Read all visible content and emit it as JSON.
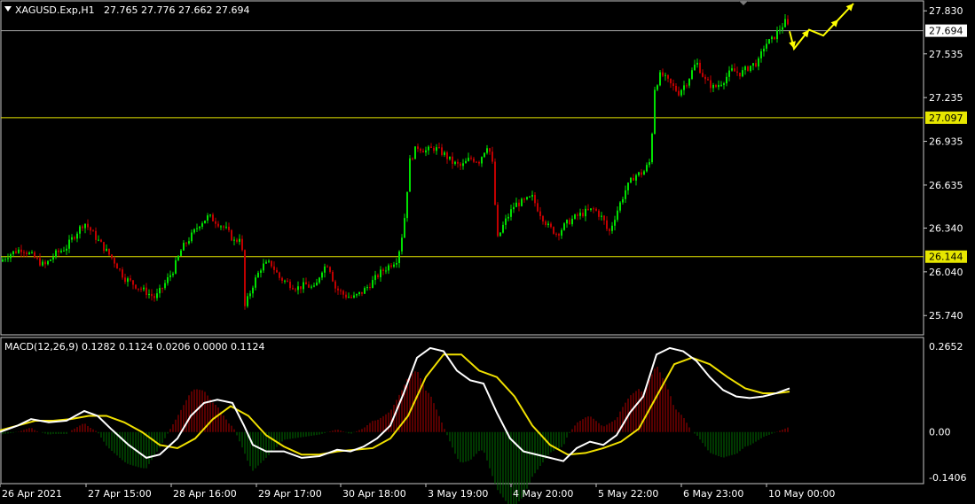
{
  "header": {
    "symbol": "XAGUSD.Exp,H1",
    "ohlc": "27.765 27.776 27.662 27.694"
  },
  "macd_header": "MACD(12,26,9) 0.1282 0.1124 0.0206 0.0000 0.1124",
  "colors": {
    "background": "#000000",
    "bull": "#00e000",
    "bear": "#c00000",
    "hline": "#e6e600",
    "bidline": "#a0a0a0",
    "macd_line": "#ffffff",
    "signal_line": "#f0e000",
    "hist_pos": "#b00000",
    "hist_neg": "#007000",
    "arrows": "#ffff00"
  },
  "chart_data": [
    {
      "type": "candlestick",
      "symbol": "XAGUSD.Exp",
      "timeframe": "H1",
      "price_ticks": [
        "27.830",
        "27.535",
        "27.235",
        "26.935",
        "26.635",
        "26.340",
        "26.040",
        "25.740"
      ],
      "ylim": [
        25.62,
        27.88
      ],
      "current_price": "27.694",
      "levels": [
        "27.097",
        "26.144"
      ],
      "x_ticks": [
        "26 Apr 2021",
        "27 Apr 15:00",
        "28 Apr 16:00",
        "29 Apr 17:00",
        "30 Apr 18:00",
        "3 May 19:00",
        "4 May 20:00",
        "5 May 22:00",
        "6 May 23:00",
        "10 May 00:00"
      ],
      "close_path": [
        [
          0,
          26.11
        ],
        [
          10,
          26.16
        ],
        [
          25,
          26.2
        ],
        [
          38,
          26.14
        ],
        [
          50,
          26.08
        ],
        [
          62,
          26.16
        ],
        [
          75,
          26.21
        ],
        [
          85,
          26.3
        ],
        [
          95,
          26.38
        ],
        [
          105,
          26.3
        ],
        [
          115,
          26.22
        ],
        [
          128,
          26.12
        ],
        [
          140,
          26.0
        ],
        [
          152,
          25.95
        ],
        [
          165,
          25.9
        ],
        [
          175,
          25.86
        ],
        [
          185,
          25.95
        ],
        [
          195,
          26.05
        ],
        [
          205,
          26.2
        ],
        [
          215,
          26.28
        ],
        [
          225,
          26.37
        ],
        [
          235,
          26.42
        ],
        [
          245,
          26.38
        ],
        [
          255,
          26.33
        ],
        [
          265,
          26.24
        ],
        [
          272,
          26.3
        ],
        [
          276,
          25.8
        ],
        [
          285,
          25.95
        ],
        [
          295,
          26.08
        ],
        [
          305,
          26.1
        ],
        [
          315,
          26.0
        ],
        [
          325,
          25.96
        ],
        [
          335,
          25.93
        ],
        [
          345,
          25.95
        ],
        [
          355,
          25.92
        ],
        [
          362,
          26.05
        ],
        [
          370,
          26.1
        ],
        [
          378,
          25.93
        ],
        [
          388,
          25.88
        ],
        [
          398,
          25.86
        ],
        [
          408,
          25.9
        ],
        [
          418,
          25.96
        ],
        [
          428,
          26.03
        ],
        [
          438,
          26.08
        ],
        [
          448,
          26.13
        ],
        [
          455,
          26.35
        ],
        [
          462,
          26.8
        ],
        [
          470,
          26.9
        ],
        [
          480,
          26.87
        ],
        [
          490,
          26.89
        ],
        [
          500,
          26.85
        ],
        [
          510,
          26.79
        ],
        [
          520,
          26.76
        ],
        [
          530,
          26.82
        ],
        [
          540,
          26.8
        ],
        [
          550,
          26.92
        ],
        [
          556,
          26.75
        ],
        [
          560,
          26.25
        ],
        [
          568,
          26.37
        ],
        [
          580,
          26.5
        ],
        [
          590,
          26.52
        ],
        [
          600,
          26.55
        ],
        [
          608,
          26.45
        ],
        [
          618,
          26.35
        ],
        [
          628,
          26.3
        ],
        [
          640,
          26.38
        ],
        [
          650,
          26.42
        ],
        [
          660,
          26.45
        ],
        [
          670,
          26.47
        ],
        [
          680,
          26.4
        ],
        [
          686,
          26.3
        ],
        [
          695,
          26.45
        ],
        [
          705,
          26.6
        ],
        [
          715,
          26.7
        ],
        [
          725,
          26.72
        ],
        [
          733,
          26.8
        ],
        [
          738,
          27.3
        ],
        [
          745,
          27.4
        ],
        [
          755,
          27.33
        ],
        [
          765,
          27.27
        ],
        [
          775,
          27.35
        ],
        [
          785,
          27.48
        ],
        [
          795,
          27.35
        ],
        [
          805,
          27.3
        ],
        [
          815,
          27.35
        ],
        [
          825,
          27.42
        ],
        [
          835,
          27.4
        ],
        [
          845,
          27.45
        ],
        [
          855,
          27.48
        ],
        [
          862,
          27.6
        ],
        [
          870,
          27.63
        ],
        [
          878,
          27.7
        ],
        [
          886,
          27.76
        ],
        [
          890,
          27.69
        ]
      ],
      "forecast_arrows": [
        [
          890,
          27.69
        ],
        [
          895,
          27.57
        ],
        [
          912,
          27.7
        ],
        [
          928,
          27.66
        ],
        [
          945,
          27.77
        ],
        [
          962,
          27.88
        ]
      ]
    },
    {
      "type": "line",
      "indicator": "MACD",
      "params": "12,26,9",
      "y_ticks": [
        "0.2652",
        "0.00",
        "-0.1406"
      ],
      "ylim": [
        -0.1406,
        0.2652
      ],
      "series": [
        {
          "role": "macd",
          "points": [
            [
              0,
              0.0
            ],
            [
              20,
              0.02
            ],
            [
              35,
              0.04
            ],
            [
              55,
              0.03
            ],
            [
              75,
              0.035
            ],
            [
              95,
              0.065
            ],
            [
              110,
              0.05
            ],
            [
              125,
              0.01
            ],
            [
              145,
              -0.04
            ],
            [
              165,
              -0.08
            ],
            [
              180,
              -0.07
            ],
            [
              200,
              -0.02
            ],
            [
              215,
              0.05
            ],
            [
              230,
              0.09
            ],
            [
              245,
              0.1
            ],
            [
              262,
              0.09
            ],
            [
              275,
              0.02
            ],
            [
              285,
              -0.04
            ],
            [
              300,
              -0.06
            ],
            [
              320,
              -0.06
            ],
            [
              340,
              -0.08
            ],
            [
              360,
              -0.075
            ],
            [
              380,
              -0.055
            ],
            [
              395,
              -0.06
            ],
            [
              410,
              -0.045
            ],
            [
              425,
              -0.02
            ],
            [
              440,
              0.02
            ],
            [
              455,
              0.12
            ],
            [
              470,
              0.23
            ],
            [
              485,
              0.26
            ],
            [
              500,
              0.25
            ],
            [
              515,
              0.19
            ],
            [
              530,
              0.16
            ],
            [
              545,
              0.15
            ],
            [
              560,
              0.06
            ],
            [
              575,
              -0.02
            ],
            [
              590,
              -0.06
            ],
            [
              605,
              -0.07
            ],
            [
              620,
              -0.08
            ],
            [
              635,
              -0.09
            ],
            [
              650,
              -0.05
            ],
            [
              665,
              -0.03
            ],
            [
              680,
              -0.04
            ],
            [
              695,
              -0.01
            ],
            [
              710,
              0.06
            ],
            [
              725,
              0.11
            ],
            [
              740,
              0.24
            ],
            [
              755,
              0.26
            ],
            [
              770,
              0.25
            ],
            [
              785,
              0.22
            ],
            [
              800,
              0.17
            ],
            [
              815,
              0.13
            ],
            [
              830,
              0.11
            ],
            [
              845,
              0.105
            ],
            [
              860,
              0.11
            ],
            [
              875,
              0.12
            ],
            [
              890,
              0.135
            ]
          ]
        },
        {
          "role": "signal",
          "points": [
            [
              0,
              0.005
            ],
            [
              20,
              0.02
            ],
            [
              40,
              0.035
            ],
            [
              60,
              0.035
            ],
            [
              80,
              0.04
            ],
            [
              100,
              0.05
            ],
            [
              120,
              0.05
            ],
            [
              140,
              0.03
            ],
            [
              160,
              0.0
            ],
            [
              180,
              -0.04
            ],
            [
              200,
              -0.05
            ],
            [
              220,
              -0.02
            ],
            [
              240,
              0.04
            ],
            [
              260,
              0.08
            ],
            [
              280,
              0.05
            ],
            [
              300,
              -0.01
            ],
            [
              320,
              -0.045
            ],
            [
              340,
              -0.07
            ],
            [
              360,
              -0.07
            ],
            [
              380,
              -0.06
            ],
            [
              400,
              -0.055
            ],
            [
              420,
              -0.05
            ],
            [
              440,
              -0.02
            ],
            [
              460,
              0.05
            ],
            [
              480,
              0.17
            ],
            [
              500,
              0.24
            ],
            [
              520,
              0.24
            ],
            [
              540,
              0.19
            ],
            [
              560,
              0.17
            ],
            [
              580,
              0.11
            ],
            [
              600,
              0.02
            ],
            [
              620,
              -0.04
            ],
            [
              640,
              -0.07
            ],
            [
              660,
              -0.065
            ],
            [
              680,
              -0.05
            ],
            [
              700,
              -0.03
            ],
            [
              720,
              0.01
            ],
            [
              740,
              0.11
            ],
            [
              760,
              0.21
            ],
            [
              780,
              0.23
            ],
            [
              800,
              0.21
            ],
            [
              820,
              0.17
            ],
            [
              840,
              0.135
            ],
            [
              860,
              0.12
            ],
            [
              875,
              0.12
            ],
            [
              890,
              0.125
            ]
          ]
        }
      ]
    }
  ]
}
